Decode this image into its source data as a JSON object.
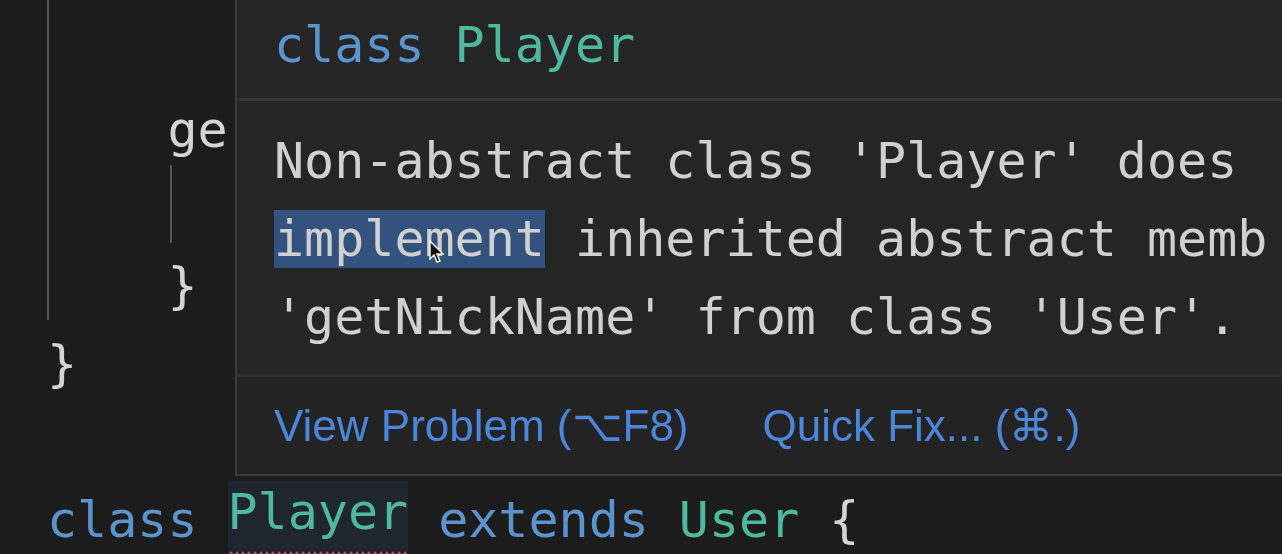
{
  "editor": {
    "lines": [
      {
        "kind": "blank"
      },
      {
        "kind": "code",
        "tokens": [
          {
            "text": "    ge",
            "kind": "plain",
            "error": false
          }
        ]
      },
      {
        "kind": "blank"
      },
      {
        "kind": "code",
        "tokens": [
          {
            "text": "    }",
            "kind": "plain",
            "error": false
          }
        ]
      },
      {
        "kind": "code",
        "tokens": [
          {
            "text": "}",
            "kind": "plain",
            "error": false
          }
        ]
      },
      {
        "kind": "blank"
      },
      {
        "kind": "code",
        "tokens": [
          {
            "text": "class",
            "kind": "keyword",
            "error": false
          },
          {
            "text": "Player",
            "kind": "type",
            "error": true
          },
          {
            "text": "extends",
            "kind": "keyword",
            "error": false
          },
          {
            "text": "User",
            "kind": "type",
            "error": false
          },
          {
            "text": "{",
            "kind": "plain",
            "error": false
          }
        ]
      }
    ]
  },
  "hover": {
    "signature": [
      {
        "text": "class",
        "kind": "keyword"
      },
      {
        "text": "Player",
        "kind": "type"
      }
    ],
    "message": [
      [
        {
          "text": "Non-abstract class 'Player' does",
          "selected": false
        }
      ],
      [
        {
          "text": "implement",
          "selected": true
        },
        {
          "text": " inherited abstract memb",
          "selected": false
        }
      ],
      [
        {
          "text": "'getNickName' from class 'User'.",
          "selected": false
        }
      ]
    ],
    "actions": [
      "View Problem (⌥F8)",
      "Quick Fix... (⌘.)"
    ]
  }
}
